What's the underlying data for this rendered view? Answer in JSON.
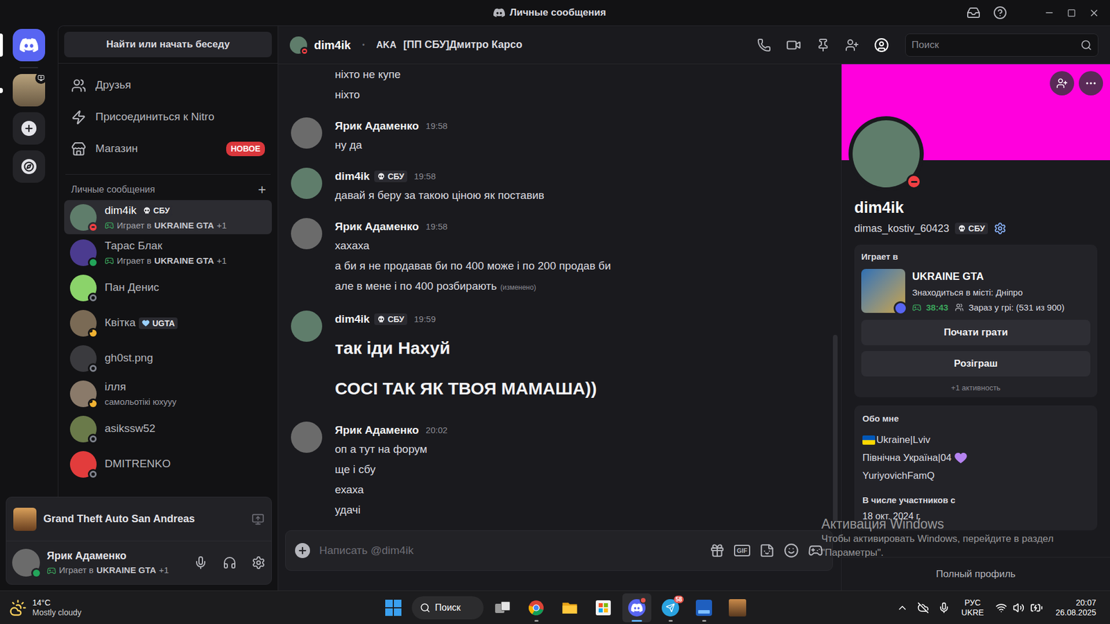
{
  "window": {
    "title": "Личные сообщения"
  },
  "rail": [
    {
      "kind": "home",
      "selected": true,
      "unread": false
    },
    {
      "kind": "server",
      "selected": false,
      "unread": true
    },
    {
      "kind": "add",
      "selected": false,
      "unread": false
    },
    {
      "kind": "discover",
      "selected": false,
      "unread": false
    }
  ],
  "dm_sidebar": {
    "search": "Найти или начать беседу",
    "nav": [
      {
        "kind": "friends",
        "label": "Друзья",
        "badge": ""
      },
      {
        "kind": "nitro",
        "label": "Присоединиться к Nitro",
        "badge": ""
      },
      {
        "kind": "shop",
        "label": "Магазин",
        "badge": "НОВОЕ"
      }
    ],
    "section": {
      "title": "Личные сообщения",
      "action": "+"
    },
    "items": [
      {
        "name": "dim4ik",
        "badge": "СБУ",
        "badge_kind": "skull",
        "activity": {
          "prefix": "Играет в",
          "game": "UKRAINE GTA",
          "extra": "+1"
        },
        "subtitle": "",
        "status": "dnd",
        "color": "#f23f43",
        "selected": true
      },
      {
        "name": "Тарас Блак",
        "badge": "",
        "badge_kind": "none",
        "activity": {
          "prefix": "Играет в",
          "game": "UKRAINE GTA",
          "extra": "+1"
        },
        "subtitle": "",
        "status": "online",
        "color": "#23a55a",
        "selected": false
      },
      {
        "name": "Пан Денис",
        "badge": "",
        "badge_kind": "none",
        "activity": null,
        "subtitle": "",
        "status": "offline",
        "color": "#80848e",
        "selected": false
      },
      {
        "name": "Квітка",
        "badge": "UGTA",
        "badge_kind": "heart",
        "activity": null,
        "subtitle": "",
        "status": "idle",
        "color": "#f0b232",
        "selected": false
      },
      {
        "name": "gh0st.png",
        "badge": "",
        "badge_kind": "none",
        "activity": null,
        "subtitle": "",
        "status": "offline",
        "color": "#80848e",
        "selected": false
      },
      {
        "name": "ілля",
        "badge": "",
        "badge_kind": "none",
        "activity": null,
        "subtitle": "самольотікі юхууу",
        "status": "idle",
        "color": "#f0b232",
        "selected": false
      },
      {
        "name": "asikssw52",
        "badge": "",
        "badge_kind": "none",
        "activity": null,
        "subtitle": "",
        "status": "offline",
        "color": "#80848e",
        "selected": false
      },
      {
        "name": "DMITRENKO",
        "badge": "",
        "badge_kind": "none",
        "activity": null,
        "subtitle": "",
        "status": "offline",
        "color": "#80848e",
        "selected": false
      }
    ]
  },
  "activity_panel": {
    "title": "Grand Theft Auto San Andreas"
  },
  "user_panel": {
    "name": "Ярик Адаменко",
    "status": "online",
    "color": "#23a55a",
    "activity": {
      "prefix": "Играет в",
      "game": "UKRAINE GTA",
      "extra": "+1"
    }
  },
  "chat": {
    "header": {
      "name": "dim4ik",
      "status": "dnd",
      "color": "#f23f43",
      "separator": "•",
      "aka": "AKA",
      "alias": "[ПП СБУ]Дмитро Карсо"
    },
    "search_placeholder": "Поиск",
    "messages": [
      {
        "author": "",
        "badge": "",
        "time": "",
        "continuation": true,
        "lines": [
          {
            "text": "ніхто не купе",
            "kind": "normal",
            "edited": ""
          },
          {
            "text": "ніхто",
            "kind": "normal",
            "edited": ""
          }
        ]
      },
      {
        "author": "Ярик Адаменко",
        "badge": "",
        "time": "19:58",
        "continuation": false,
        "lines": [
          {
            "text": "ну да",
            "kind": "normal",
            "edited": ""
          }
        ]
      },
      {
        "author": "dim4ik",
        "badge": "СБУ",
        "time": "19:58",
        "continuation": false,
        "lines": [
          {
            "text": "давай я беру за такою ціною як поставив",
            "kind": "normal",
            "edited": ""
          }
        ]
      },
      {
        "author": "Ярик Адаменко",
        "badge": "",
        "time": "19:58",
        "continuation": false,
        "lines": [
          {
            "text": "хахаха",
            "kind": "normal",
            "edited": ""
          },
          {
            "text": "а би я не продавав би по 400 може і по 200 продав би",
            "kind": "normal",
            "edited": ""
          },
          {
            "text": "але в мене і по 400 розбирають",
            "kind": "normal",
            "edited": "(изменено)"
          }
        ]
      },
      {
        "author": "dim4ik",
        "badge": "СБУ",
        "time": "19:59",
        "continuation": false,
        "lines": [
          {
            "text": "так іди Нахуй",
            "kind": "heading",
            "edited": ""
          },
          {
            "text": "СОСІ ТАК ЯК ТВОЯ МАМАША))",
            "kind": "heading",
            "edited": ""
          }
        ]
      },
      {
        "author": "Ярик Адаменко",
        "badge": "",
        "time": "20:02",
        "continuation": false,
        "lines": [
          {
            "text": "оп а тут на форум",
            "kind": "normal",
            "edited": ""
          },
          {
            "text": "ще і сбу",
            "kind": "normal",
            "edited": ""
          },
          {
            "text": "ехаха",
            "kind": "normal",
            "edited": ""
          },
          {
            "text": "удачі",
            "kind": "normal",
            "edited": ""
          }
        ]
      }
    ],
    "input_placeholder": "Написать @dim4ik",
    "gif_label": "GIF"
  },
  "profile": {
    "display_name": "dim4ik",
    "username": "dimas_kostiv_60423",
    "badge": "СБУ",
    "status": "dnd",
    "color": "#f23f43",
    "activity": {
      "heading": "Играет в",
      "game": "UKRAINE GTA",
      "details": "Знаходиться в місті: Дніпро",
      "elapsed": "38:43",
      "players": "Зараз у грі: (531 из 900)",
      "buttons": [
        "Почати грати",
        "Розіграш"
      ],
      "more": "+1 активность"
    },
    "about": {
      "heading": "Обо мне",
      "lines": [
        {
          "text": "Ukraine|Lviv",
          "kind": "flag-prefix"
        },
        {
          "text": "Північна Україна|04",
          "kind": "heart-suffix"
        },
        {
          "text": "YuriyovichFamQ",
          "kind": "plain"
        }
      ]
    },
    "member_since": {
      "heading": "В числе участников с",
      "date": "18 окт. 2024 г."
    },
    "full_profile": "Полный профиль"
  },
  "watermark": {
    "title": "Активация Windows",
    "line1": "Чтобы активировать Windows, перейдите в раздел",
    "line2": "\"Параметры\"."
  },
  "taskbar": {
    "weather": {
      "temp": "14°C",
      "text": "Mostly cloudy"
    },
    "search": "Поиск",
    "apps": [
      {
        "kind": "taskview",
        "running": false,
        "active": false,
        "alert": false,
        "badge": ""
      },
      {
        "kind": "chrome",
        "running": true,
        "active": false,
        "alert": false,
        "badge": ""
      },
      {
        "kind": "explorer",
        "running": false,
        "active": false,
        "alert": false,
        "badge": ""
      },
      {
        "kind": "store",
        "running": false,
        "active": false,
        "alert": false,
        "badge": ""
      },
      {
        "kind": "discord",
        "running": true,
        "active": true,
        "alert": true,
        "badge": ""
      },
      {
        "kind": "telegram",
        "running": true,
        "active": false,
        "alert": false,
        "badge": "58"
      },
      {
        "kind": "blueapp",
        "running": true,
        "active": false,
        "alert": false,
        "badge": ""
      },
      {
        "kind": "game",
        "running": false,
        "active": false,
        "alert": false,
        "badge": ""
      }
    ],
    "tray": {
      "language": "РУС",
      "layout": "UKRE",
      "time": "20:07",
      "date": "26.08.2025"
    }
  }
}
